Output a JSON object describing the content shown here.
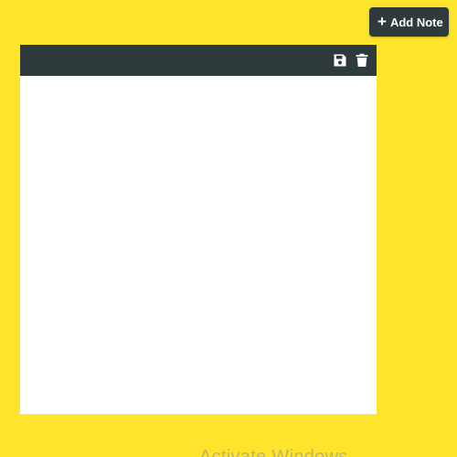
{
  "toolbar": {
    "add_note_label": "Add Note",
    "add_note_icon": "plus-icon"
  },
  "note": {
    "header_bg": "#2f3a3c",
    "actions": [
      {
        "name": "save",
        "icon": "save-icon"
      },
      {
        "name": "delete",
        "icon": "trash-icon"
      }
    ],
    "content": ""
  },
  "watermark": {
    "text": "Activate Windows"
  },
  "colors": {
    "background": "#ffe42e",
    "accent_dark": "#2f3a3c",
    "note_bg": "#ffffff"
  }
}
